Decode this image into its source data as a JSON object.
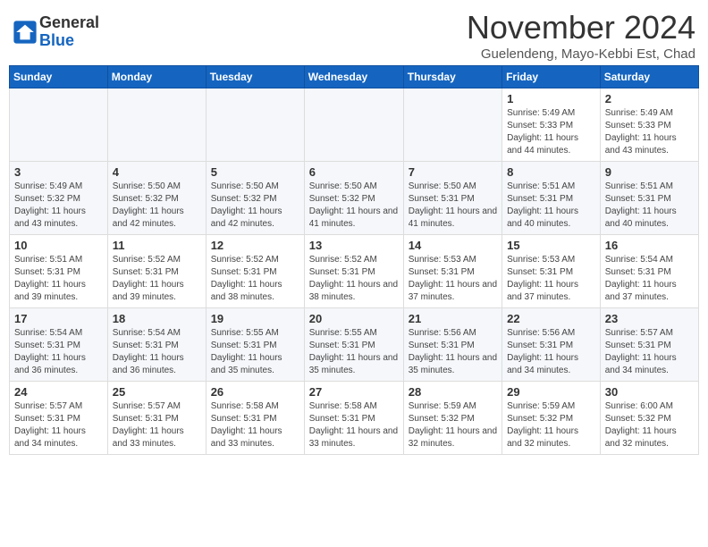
{
  "header": {
    "logo_general": "General",
    "logo_blue": "Blue",
    "month_title": "November 2024",
    "subtitle": "Guelendeng, Mayo-Kebbi Est, Chad"
  },
  "weekdays": [
    "Sunday",
    "Monday",
    "Tuesday",
    "Wednesday",
    "Thursday",
    "Friday",
    "Saturday"
  ],
  "weeks": [
    [
      {
        "day": "",
        "info": ""
      },
      {
        "day": "",
        "info": ""
      },
      {
        "day": "",
        "info": ""
      },
      {
        "day": "",
        "info": ""
      },
      {
        "day": "",
        "info": ""
      },
      {
        "day": "1",
        "info": "Sunrise: 5:49 AM\nSunset: 5:33 PM\nDaylight: 11 hours and 44 minutes."
      },
      {
        "day": "2",
        "info": "Sunrise: 5:49 AM\nSunset: 5:33 PM\nDaylight: 11 hours and 43 minutes."
      }
    ],
    [
      {
        "day": "3",
        "info": "Sunrise: 5:49 AM\nSunset: 5:32 PM\nDaylight: 11 hours and 43 minutes."
      },
      {
        "day": "4",
        "info": "Sunrise: 5:50 AM\nSunset: 5:32 PM\nDaylight: 11 hours and 42 minutes."
      },
      {
        "day": "5",
        "info": "Sunrise: 5:50 AM\nSunset: 5:32 PM\nDaylight: 11 hours and 42 minutes."
      },
      {
        "day": "6",
        "info": "Sunrise: 5:50 AM\nSunset: 5:32 PM\nDaylight: 11 hours and 41 minutes."
      },
      {
        "day": "7",
        "info": "Sunrise: 5:50 AM\nSunset: 5:31 PM\nDaylight: 11 hours and 41 minutes."
      },
      {
        "day": "8",
        "info": "Sunrise: 5:51 AM\nSunset: 5:31 PM\nDaylight: 11 hours and 40 minutes."
      },
      {
        "day": "9",
        "info": "Sunrise: 5:51 AM\nSunset: 5:31 PM\nDaylight: 11 hours and 40 minutes."
      }
    ],
    [
      {
        "day": "10",
        "info": "Sunrise: 5:51 AM\nSunset: 5:31 PM\nDaylight: 11 hours and 39 minutes."
      },
      {
        "day": "11",
        "info": "Sunrise: 5:52 AM\nSunset: 5:31 PM\nDaylight: 11 hours and 39 minutes."
      },
      {
        "day": "12",
        "info": "Sunrise: 5:52 AM\nSunset: 5:31 PM\nDaylight: 11 hours and 38 minutes."
      },
      {
        "day": "13",
        "info": "Sunrise: 5:52 AM\nSunset: 5:31 PM\nDaylight: 11 hours and 38 minutes."
      },
      {
        "day": "14",
        "info": "Sunrise: 5:53 AM\nSunset: 5:31 PM\nDaylight: 11 hours and 37 minutes."
      },
      {
        "day": "15",
        "info": "Sunrise: 5:53 AM\nSunset: 5:31 PM\nDaylight: 11 hours and 37 minutes."
      },
      {
        "day": "16",
        "info": "Sunrise: 5:54 AM\nSunset: 5:31 PM\nDaylight: 11 hours and 37 minutes."
      }
    ],
    [
      {
        "day": "17",
        "info": "Sunrise: 5:54 AM\nSunset: 5:31 PM\nDaylight: 11 hours and 36 minutes."
      },
      {
        "day": "18",
        "info": "Sunrise: 5:54 AM\nSunset: 5:31 PM\nDaylight: 11 hours and 36 minutes."
      },
      {
        "day": "19",
        "info": "Sunrise: 5:55 AM\nSunset: 5:31 PM\nDaylight: 11 hours and 35 minutes."
      },
      {
        "day": "20",
        "info": "Sunrise: 5:55 AM\nSunset: 5:31 PM\nDaylight: 11 hours and 35 minutes."
      },
      {
        "day": "21",
        "info": "Sunrise: 5:56 AM\nSunset: 5:31 PM\nDaylight: 11 hours and 35 minutes."
      },
      {
        "day": "22",
        "info": "Sunrise: 5:56 AM\nSunset: 5:31 PM\nDaylight: 11 hours and 34 minutes."
      },
      {
        "day": "23",
        "info": "Sunrise: 5:57 AM\nSunset: 5:31 PM\nDaylight: 11 hours and 34 minutes."
      }
    ],
    [
      {
        "day": "24",
        "info": "Sunrise: 5:57 AM\nSunset: 5:31 PM\nDaylight: 11 hours and 34 minutes."
      },
      {
        "day": "25",
        "info": "Sunrise: 5:57 AM\nSunset: 5:31 PM\nDaylight: 11 hours and 33 minutes."
      },
      {
        "day": "26",
        "info": "Sunrise: 5:58 AM\nSunset: 5:31 PM\nDaylight: 11 hours and 33 minutes."
      },
      {
        "day": "27",
        "info": "Sunrise: 5:58 AM\nSunset: 5:31 PM\nDaylight: 11 hours and 33 minutes."
      },
      {
        "day": "28",
        "info": "Sunrise: 5:59 AM\nSunset: 5:32 PM\nDaylight: 11 hours and 32 minutes."
      },
      {
        "day": "29",
        "info": "Sunrise: 5:59 AM\nSunset: 5:32 PM\nDaylight: 11 hours and 32 minutes."
      },
      {
        "day": "30",
        "info": "Sunrise: 6:00 AM\nSunset: 5:32 PM\nDaylight: 11 hours and 32 minutes."
      }
    ]
  ]
}
